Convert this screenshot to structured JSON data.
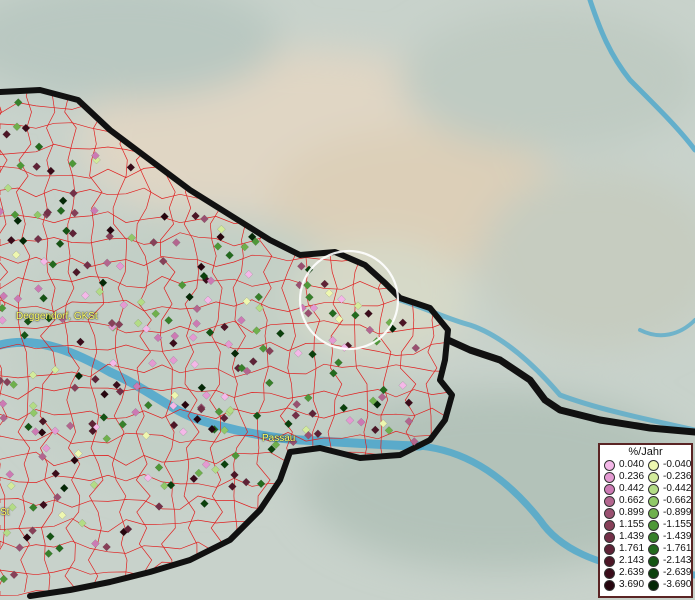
{
  "map": {
    "places": [
      {
        "id": "deggendorf",
        "label": "Deggendorf, GKSt"
      },
      {
        "id": "passau",
        "label": "Passau"
      },
      {
        "id": "left-cut",
        "label": "St"
      }
    ]
  },
  "legend": {
    "title": "%/Jahr",
    "positive": [
      {
        "value": "0.040",
        "color": "#f4b8e8"
      },
      {
        "value": "0.236",
        "color": "#e49ad2"
      },
      {
        "value": "0.442",
        "color": "#cc7ab4"
      },
      {
        "value": "0.662",
        "color": "#b3668f"
      },
      {
        "value": "0.899",
        "color": "#995070"
      },
      {
        "value": "1.155",
        "color": "#874058"
      },
      {
        "value": "1.439",
        "color": "#733048"
      },
      {
        "value": "1.761",
        "color": "#5e2236"
      },
      {
        "value": "2.143",
        "color": "#4c1626"
      },
      {
        "value": "2.639",
        "color": "#3a0c1a"
      },
      {
        "value": "3.690",
        "color": "#26050e"
      }
    ],
    "negative": [
      {
        "value": "-0.040",
        "color": "#eef7b0"
      },
      {
        "value": "-0.236",
        "color": "#d3eb9c"
      },
      {
        "value": "-0.442",
        "color": "#b3dc86"
      },
      {
        "value": "-0.662",
        "color": "#90c868"
      },
      {
        "value": "-0.899",
        "color": "#6fb04c"
      },
      {
        "value": "-1.155",
        "color": "#4e9838"
      },
      {
        "value": "-1.439",
        "color": "#37802a"
      },
      {
        "value": "-1.761",
        "color": "#236a1e"
      },
      {
        "value": "-2.143",
        "color": "#155414"
      },
      {
        "value": "-2.639",
        "color": "#0b400c"
      },
      {
        "value": "-3.690",
        "color": "#042806"
      }
    ]
  }
}
